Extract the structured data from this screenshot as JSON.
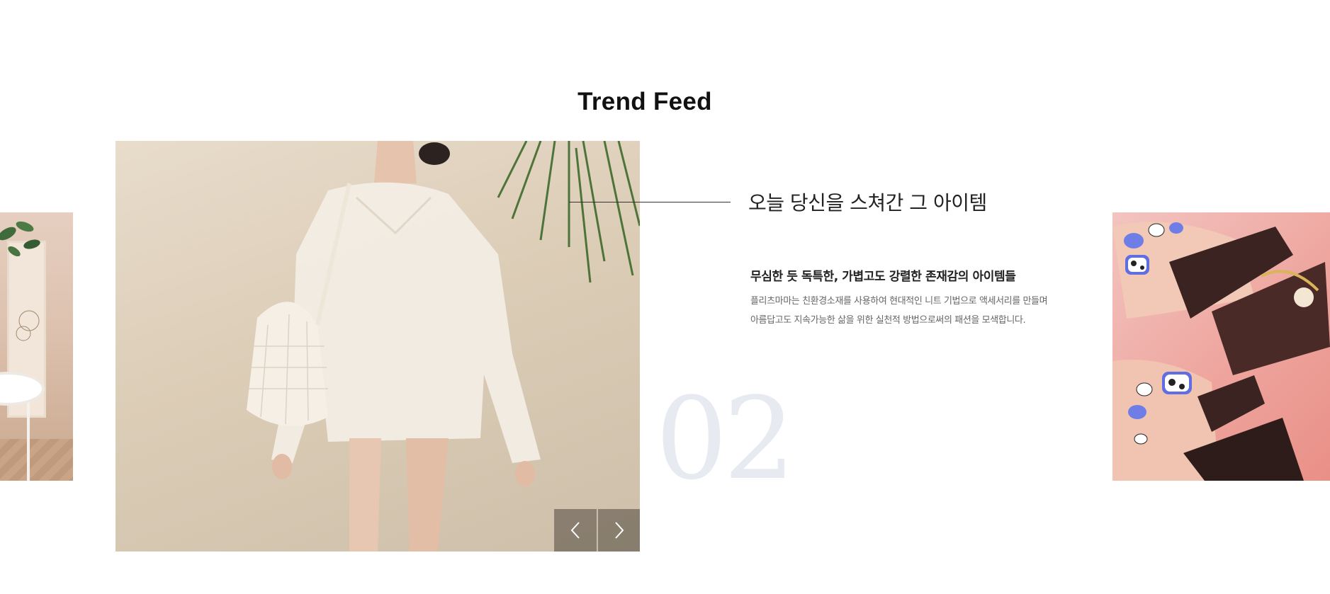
{
  "section": {
    "title": "Trend Feed"
  },
  "slide": {
    "headline": "오늘 당신을 스쳐간 그 아이템",
    "subhead": "무심한 듯 독특한, 가볍고도 강렬한 존재감의 아이템들",
    "description_lines": [
      "플리츠마마는 친환경소재를 사용하여 현대적인 니트 기법으로 액세서리를 만들며",
      "아름답고도 지속가능한 삶을 위한 실천적 방법으로써의 패션을 모색합니다."
    ],
    "number": "02"
  },
  "nav": {
    "prev_icon": "chevron-left-icon",
    "next_icon": "chevron-right-icon"
  },
  "colors": {
    "title": "#111111",
    "number": "#e7ebf1",
    "nav_bg": "#6e6458"
  }
}
